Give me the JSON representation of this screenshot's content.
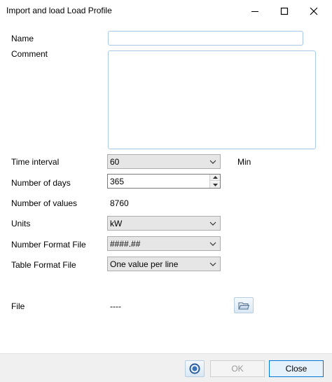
{
  "window": {
    "title": "Import and load Load Profile"
  },
  "form": {
    "name_label": "Name",
    "name_value": "",
    "comment_label": "Comment",
    "comment_value": "",
    "time_interval_label": "Time interval",
    "time_interval_value": "60",
    "time_interval_unit": "Min",
    "days_label": "Number of days",
    "days_value": "365",
    "values_label": "Number of values",
    "values_value": "8760",
    "units_label": "Units",
    "units_value": "kW",
    "number_format_label": "Number Format File",
    "number_format_value": "####.##",
    "table_format_label": "Table Format File",
    "table_format_value": "One value per line",
    "file_label": "File",
    "file_value": "----"
  },
  "footer": {
    "ok_label": "OK",
    "close_label": "Close"
  },
  "icons": {
    "minimize": "minimize-icon",
    "maximize": "maximize-icon",
    "close": "close-icon",
    "dropdown": "chevron-down-icon",
    "browse": "folder-icon",
    "help": "help-icon"
  },
  "colors": {
    "accent": "#0078d7",
    "input_border": "#a8c8e8",
    "combo_bg": "#e6e6e6",
    "footer_bg": "#f0f0f0"
  }
}
